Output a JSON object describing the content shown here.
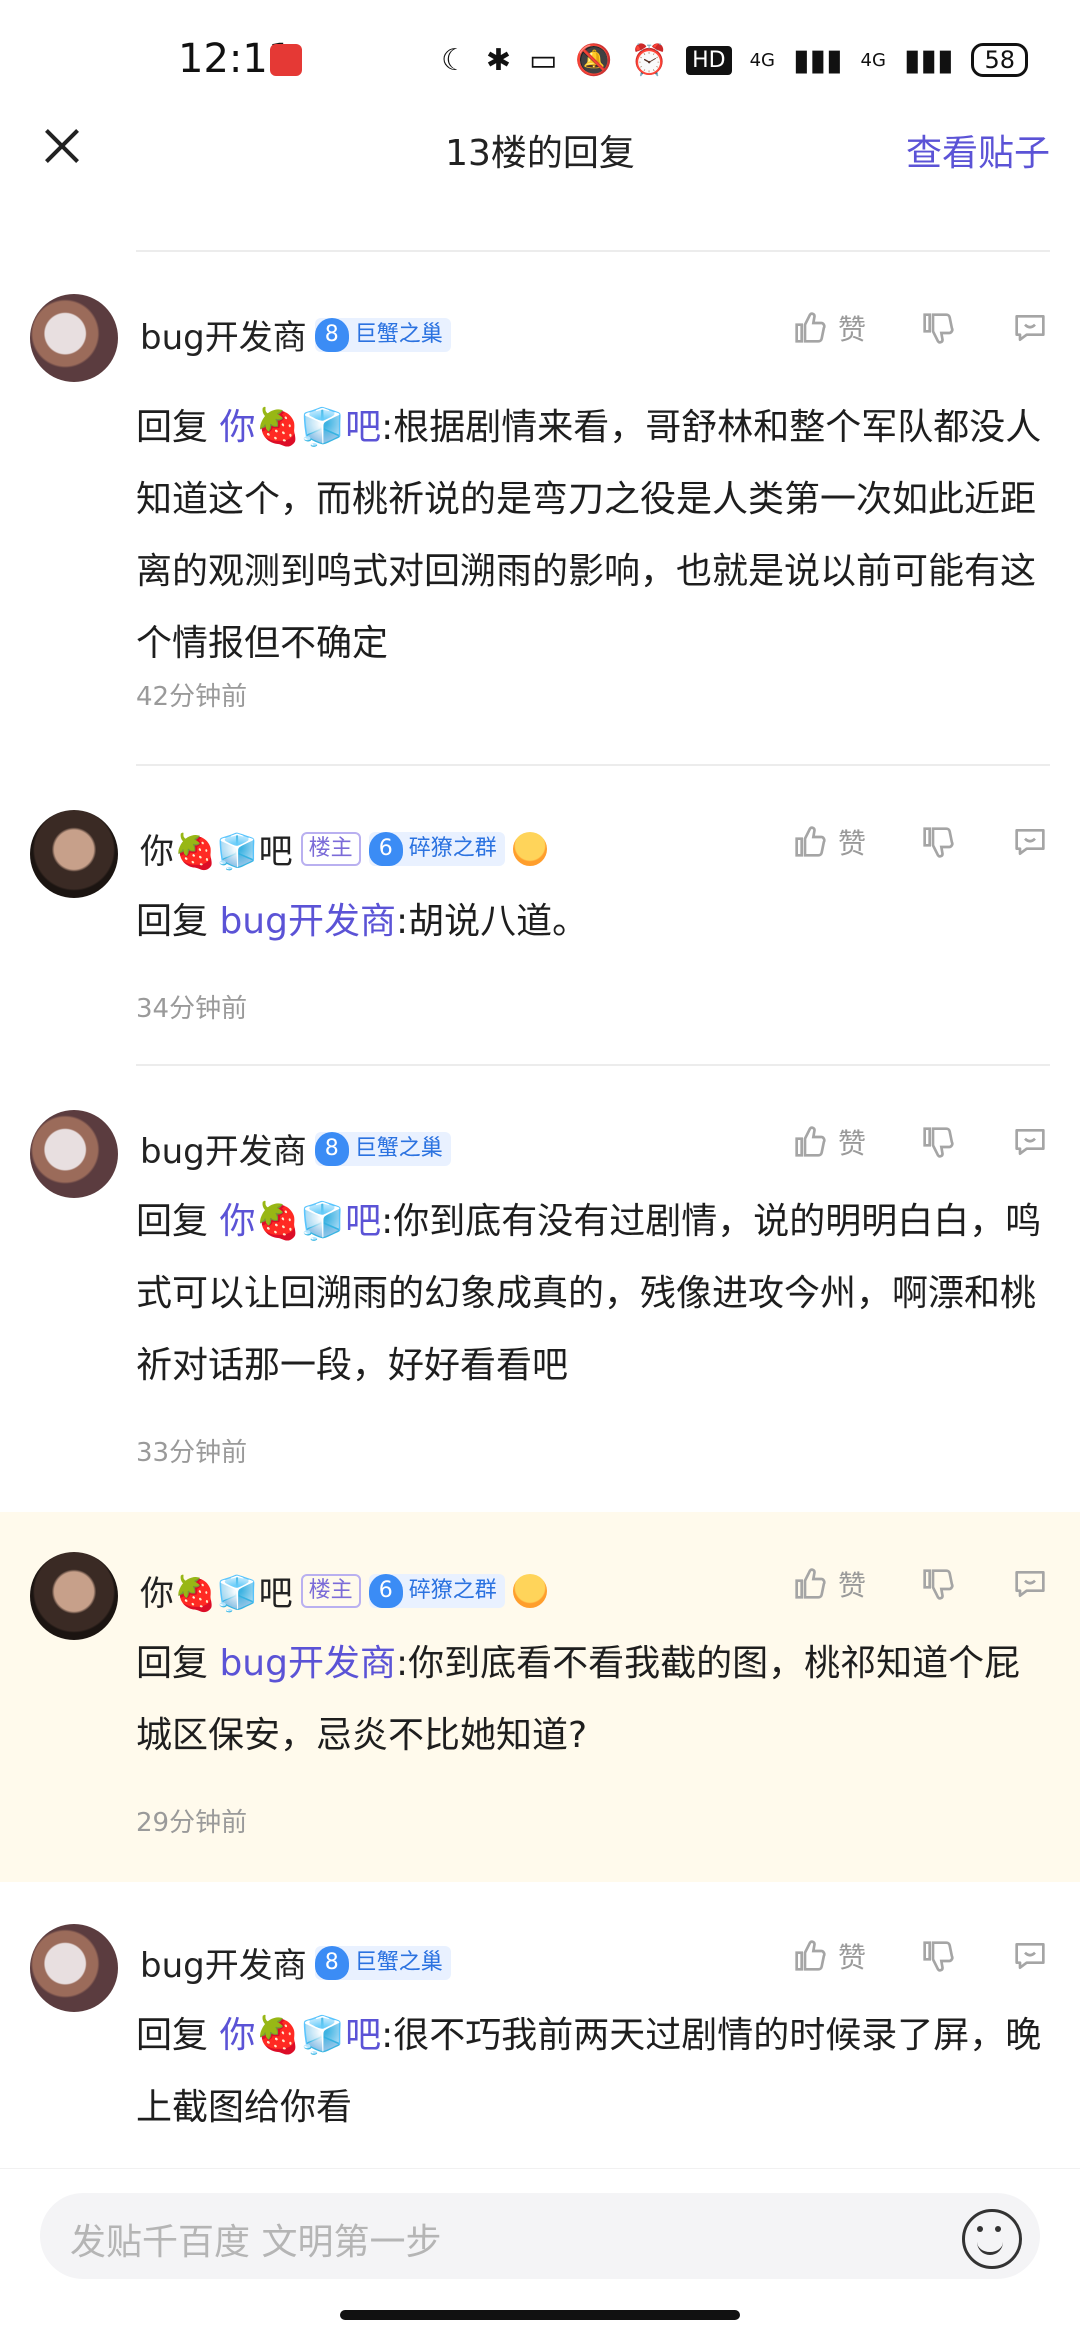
{
  "status_bar": {
    "time": "12:11",
    "hd": "HD",
    "net1": "4G",
    "net2": "4G",
    "battery": "58"
  },
  "header": {
    "title": "13楼的回复",
    "view_post": "查看贴子"
  },
  "comments": [
    {
      "username": "bug开发商",
      "level": "8",
      "group": "巨蟹之巢",
      "owner_badge": "",
      "reply_prefix": "回复 ",
      "reply_target": "你🍓🧊吧",
      "content": ":根据剧情来看，哥舒林和整个军队都没人知道这个，而桃祈说的是弯刀之役是人类第一次如此近距离的观测到鸣式对回溯雨的影响，也就是说以前可能有这个情报但不确定",
      "time": "42分钟前",
      "like": "赞"
    },
    {
      "username": "你🍓🧊吧",
      "level": "6",
      "group": "碎獠之群",
      "owner_badge": "楼主",
      "reply_prefix": "回复 ",
      "reply_target": "bug开发商",
      "content": ":胡说八道。",
      "time": "34分钟前",
      "like": "赞"
    },
    {
      "username": "bug开发商",
      "level": "8",
      "group": "巨蟹之巢",
      "owner_badge": "",
      "reply_prefix": "回复 ",
      "reply_target": "你🍓🧊吧",
      "content": ":你到底有没有过剧情，说的明明白白，鸣式可以让回溯雨的幻象成真的，残像进攻今州，啊漂和桃祈对话那一段，好好看看吧",
      "time": "33分钟前",
      "like": "赞"
    },
    {
      "username": "你🍓🧊吧",
      "level": "6",
      "group": "碎獠之群",
      "owner_badge": "楼主",
      "reply_prefix": "回复 ",
      "reply_target": "bug开发商",
      "content": ":你到底看不看我截的图，桃祁知道个屁城区保安，忌炎不比她知道?",
      "time": "29分钟前",
      "like": "赞"
    },
    {
      "username": "bug开发商",
      "level": "8",
      "group": "巨蟹之巢",
      "owner_badge": "",
      "reply_prefix": "回复 ",
      "reply_target": "你🍓🧊吧",
      "content": ":很不巧我前两天过剧情的时候录了屏，晚上截图给你看",
      "time": "",
      "like": "赞"
    }
  ],
  "input": {
    "placeholder": "发贴千百度 文明第一步"
  },
  "colors": {
    "accent": "#5b53d6",
    "highlight_bg": "#fffaec"
  }
}
